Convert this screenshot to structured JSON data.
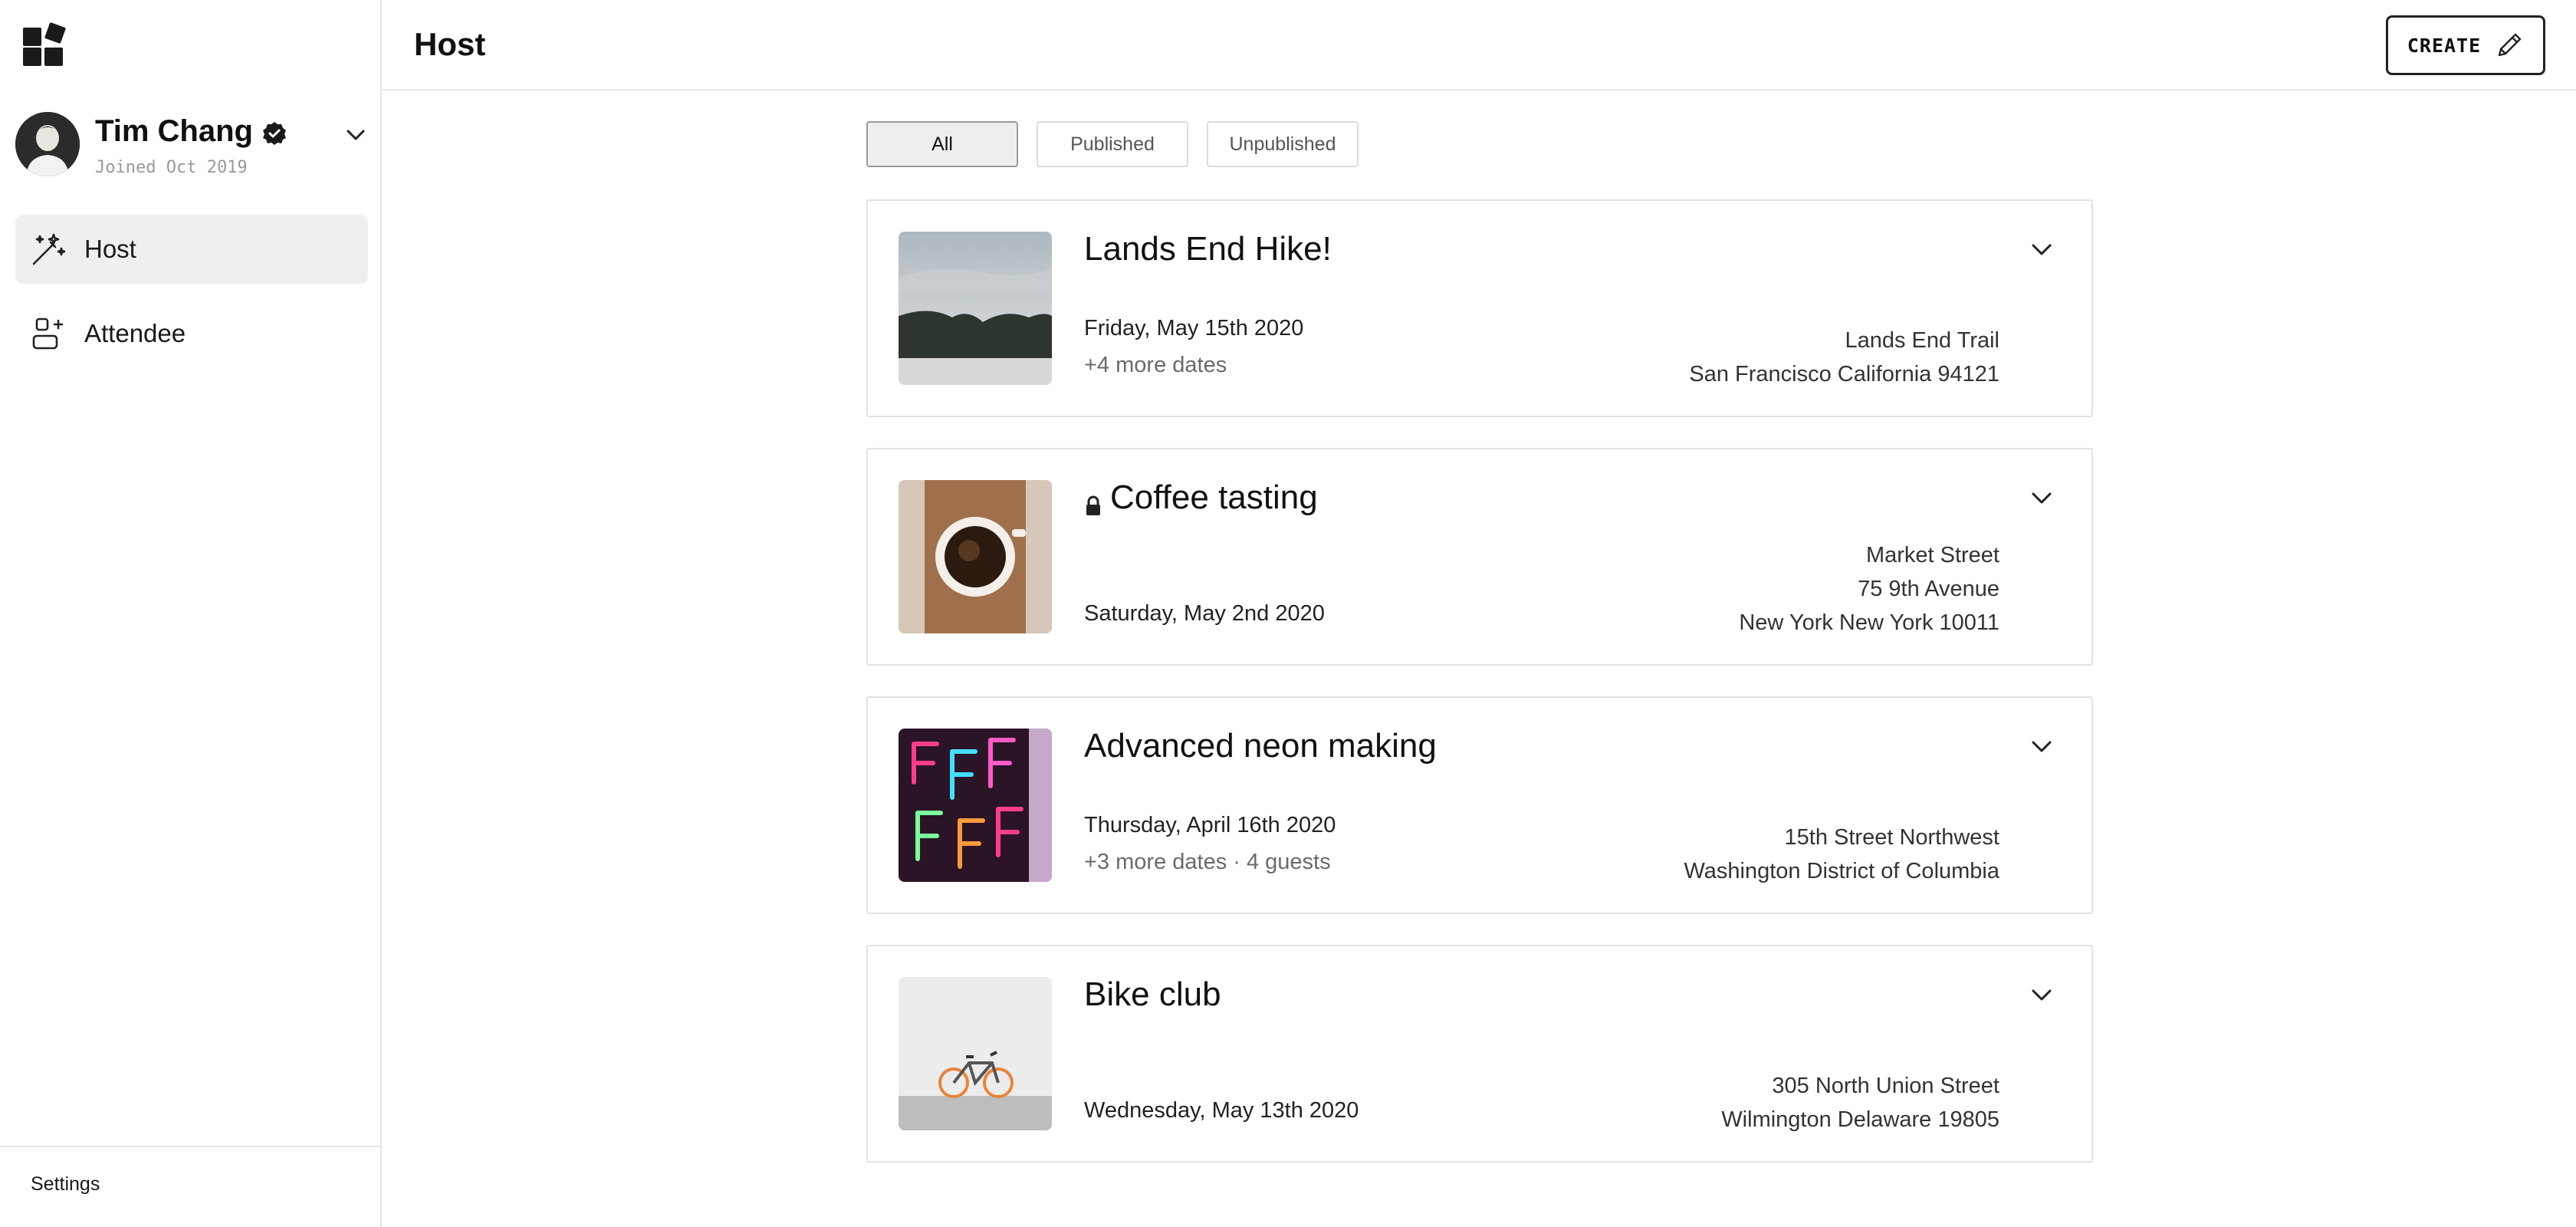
{
  "app": {
    "logo_icon": "app-logo-icon"
  },
  "profile": {
    "name": "Tim Chang",
    "joined": "Joined Oct 2019"
  },
  "nav": [
    {
      "label": "Host",
      "icon": "magic-wand-icon",
      "active": true
    },
    {
      "label": "Attendee",
      "icon": "attendee-icon",
      "active": false
    }
  ],
  "sidebar_footer": {
    "settings_label": "Settings"
  },
  "header": {
    "title": "Host",
    "create_label": "CREATE"
  },
  "filters": [
    {
      "label": "All",
      "active": true
    },
    {
      "label": "Published",
      "active": false
    },
    {
      "label": "Unpublished",
      "active": false
    }
  ],
  "events": [
    {
      "title": "Lands End Hike!",
      "locked": false,
      "date": "Friday, May 15th 2020",
      "extra": "+4 more dates",
      "address": [
        "Lands End Trail",
        "San Francisco California 94121"
      ]
    },
    {
      "title": "Coffee tasting",
      "locked": true,
      "date": "Saturday, May 2nd 2020",
      "extra": "",
      "address": [
        "Market Street",
        "75 9th Avenue",
        "New York New York 10011"
      ]
    },
    {
      "title": "Advanced neon making",
      "locked": false,
      "date": "Thursday, April 16th 2020",
      "extra": "+3 more dates · 4 guests",
      "address": [
        "15th Street Northwest",
        "Washington District of Columbia"
      ]
    },
    {
      "title": "Bike club",
      "locked": false,
      "date": "Wednesday, May 13th 2020",
      "extra": "",
      "address": [
        "305 North Union Street",
        "Wilmington Delaware 19805"
      ]
    }
  ]
}
